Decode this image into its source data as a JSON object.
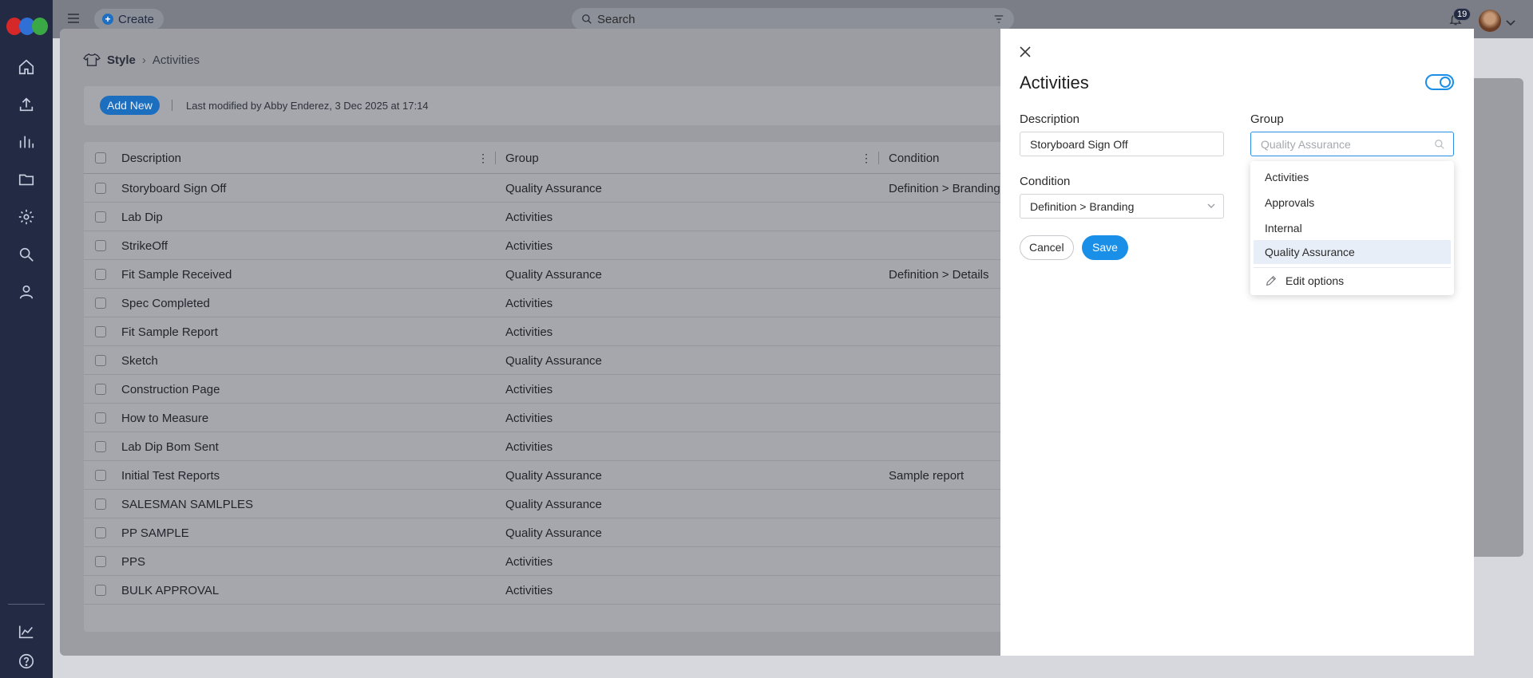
{
  "topbar": {
    "create_label": "Create",
    "search_placeholder": "Search",
    "notifications_count": "19"
  },
  "breadcrumb": {
    "root": "Style",
    "current": "Activities"
  },
  "toolbar": {
    "add_new_label": "Add New",
    "last_modified": "Last modified by Abby Enderez, 3 Dec 2025 at 17:14"
  },
  "table": {
    "columns": [
      "Description",
      "Group",
      "Condition"
    ],
    "rows": [
      {
        "description": "Storyboard Sign Off",
        "group": "Quality Assurance",
        "condition": "Definition > Branding"
      },
      {
        "description": "Lab Dip",
        "group": "Activities",
        "condition": ""
      },
      {
        "description": "StrikeOff",
        "group": "Activities",
        "condition": ""
      },
      {
        "description": "Fit Sample Received",
        "group": "Quality Assurance",
        "condition": "Definition > Details"
      },
      {
        "description": "Spec Completed",
        "group": "Activities",
        "condition": ""
      },
      {
        "description": "Fit Sample Report",
        "group": "Activities",
        "condition": ""
      },
      {
        "description": "Sketch",
        "group": "Quality Assurance",
        "condition": ""
      },
      {
        "description": "Construction Page",
        "group": "Activities",
        "condition": ""
      },
      {
        "description": "How to Measure",
        "group": "Activities",
        "condition": ""
      },
      {
        "description": "Lab Dip Bom Sent",
        "group": "Activities",
        "condition": ""
      },
      {
        "description": "Initial Test Reports",
        "group": "Quality Assurance",
        "condition": "Sample report"
      },
      {
        "description": "SALESMAN SAMLPLES",
        "group": "Quality Assurance",
        "condition": ""
      },
      {
        "description": "PP SAMPLE",
        "group": "Quality Assurance",
        "condition": ""
      },
      {
        "description": "PPS",
        "group": "Activities",
        "condition": ""
      },
      {
        "description": "BULK APPROVAL",
        "group": "Activities",
        "condition": ""
      }
    ]
  },
  "panel": {
    "title": "Activities",
    "toggle_on": true,
    "description_label": "Description",
    "description_value": "Storyboard Sign Off",
    "group_label": "Group",
    "group_placeholder": "Quality Assurance",
    "condition_label": "Condition",
    "condition_value": "Definition > Branding",
    "cancel_label": "Cancel",
    "save_label": "Save"
  },
  "dropdown": {
    "options": [
      "Activities",
      "Approvals",
      "Internal",
      "Quality Assurance"
    ],
    "highlighted": "Quality Assurance",
    "edit_label": "Edit options"
  },
  "colors": {
    "accent": "#1a8fe8",
    "rail": "#232b44",
    "logo": [
      "#d62828",
      "#2f6fd6",
      "#3aa845"
    ]
  },
  "icons": [
    "home-icon",
    "upload-icon",
    "chart-icon",
    "folder-icon",
    "gear-icon",
    "search-icon",
    "user-icon",
    "analytics-icon",
    "help-icon",
    "bell-icon",
    "filter-icon",
    "hanger-icon",
    "close-icon",
    "pencil-icon"
  ]
}
